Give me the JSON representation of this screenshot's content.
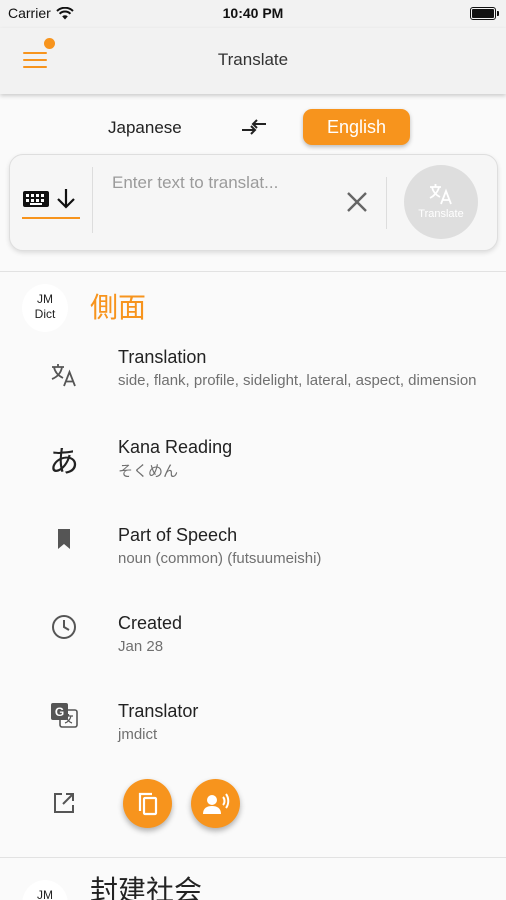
{
  "status_bar": {
    "carrier": "Carrier",
    "time": "10:40 PM"
  },
  "app_bar": {
    "title": "Translate"
  },
  "languages": {
    "source": "Japanese",
    "target": "English"
  },
  "input": {
    "placeholder": "Enter text to translat...",
    "translate_button": "Translate"
  },
  "entries": [
    {
      "source_badge": "JM\nDict",
      "headword": "側面",
      "fields": [
        {
          "label": "Translation",
          "value": "side, flank, profile, sidelight, lateral, aspect, dimension",
          "icon": "translate-icon"
        },
        {
          "label": "Kana Reading",
          "value": "そくめん",
          "icon": "hiragana-icon"
        },
        {
          "label": "Part of Speech",
          "value": "noun (common) (futsuumeishi)",
          "icon": "bookmark-icon"
        },
        {
          "label": "Created",
          "value": "Jan 28",
          "icon": "clock-icon"
        },
        {
          "label": "Translator",
          "value": "jmdict",
          "icon": "google-translate-icon"
        }
      ],
      "actions": [
        "open-external-icon",
        "copy-icon",
        "speak-icon"
      ]
    },
    {
      "source_badge": "JM",
      "headword": "封建社会"
    }
  ],
  "colors": {
    "accent": "#f7941d",
    "placeholder": "#9b9b9b",
    "secondary_text": "#707070"
  }
}
